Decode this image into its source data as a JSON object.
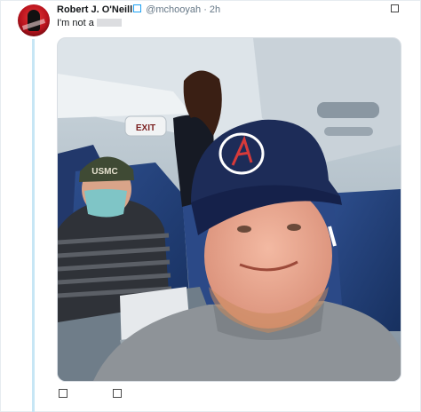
{
  "tweet": {
    "author_name": "Robert J. O'Neill",
    "handle": "@mchooyah",
    "separator": "·",
    "time": "2h",
    "text": "I'm not a"
  },
  "photo": {
    "exit_sign": "EXIT",
    "cap_text": "USMC"
  },
  "icons": {
    "verified": "verified-badge-icon",
    "caret": "chevron-down-icon",
    "reply": "reply-icon",
    "retweet": "retweet-icon"
  },
  "colors": {
    "thread_line": "#c7e6f5",
    "verified": "#1da1f2",
    "muted_text": "#657786"
  }
}
